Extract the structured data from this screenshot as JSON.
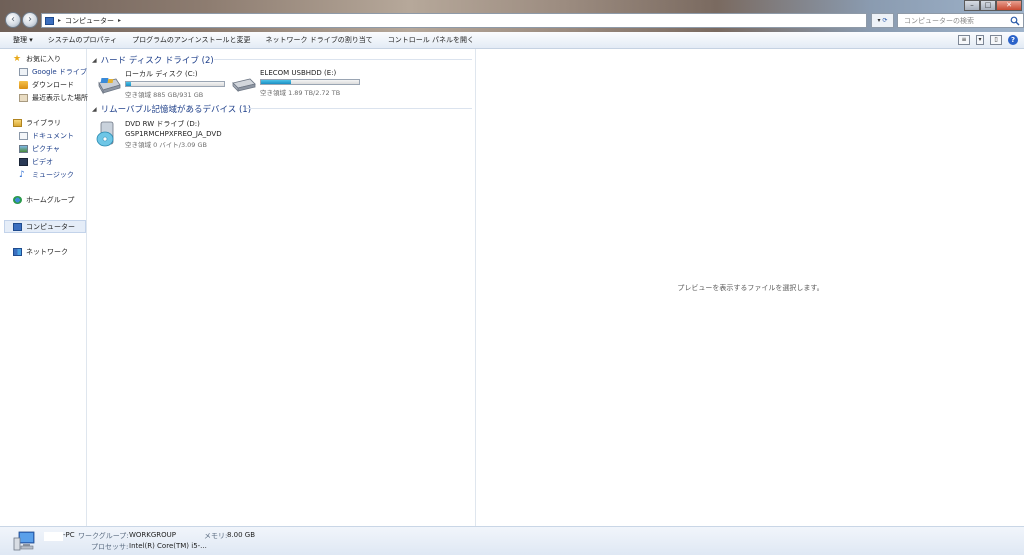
{
  "address": {
    "breadcrumb": "コンピューター"
  },
  "search": {
    "placeholder": "コンピューターの検索"
  },
  "toolbar": {
    "organize": "整理 ▾",
    "system_properties": "システムのプロパティ",
    "uninstall": "プログラムのアンインストールと変更",
    "map_drive": "ネットワーク ドライブの割り当て",
    "control_panel": "コントロール パネルを開く"
  },
  "nav": {
    "favorites": "お気に入り",
    "google_drive": "Google ドライブ",
    "downloads": "ダウンロード",
    "recent": "最近表示した場所",
    "libraries": "ライブラリ",
    "documents": "ドキュメント",
    "pictures": "ピクチャ",
    "videos": "ビデオ",
    "music": "ミュージック",
    "homegroup": "ホームグループ",
    "computer": "コンピューター",
    "network": "ネットワーク"
  },
  "groups": {
    "hdd": "ハード ディスク ドライブ (2)",
    "removable": "リムーバブル記憶域があるデバイス (1)"
  },
  "drives": {
    "c": {
      "name": "ローカル ディスク (C:)",
      "free": "空き領域 885 GB/931 GB",
      "used_fraction": 0.05
    },
    "e": {
      "name": "ELECOM USBHDD (E:)",
      "free": "空き領域 1.89 TB/2.72 TB",
      "used_fraction": 0.31
    },
    "d": {
      "name": "DVD RW ドライブ (D:)",
      "label": "GSP1RMCHPXFREO_JA_DVD",
      "free": "空き領域 0 バイト/3.09 GB"
    }
  },
  "preview": {
    "message": "プレビューを表示するファイルを選択します。"
  },
  "details": {
    "pc_name": "-PC",
    "workgroup_label": "ワークグループ:",
    "workgroup_value": "WORKGROUP",
    "memory_label": "メモリ:",
    "memory_value": "8.00 GB",
    "processor_label": "プロセッサ:",
    "processor_value": "Intel(R) Core(TM) i5-..."
  },
  "colors": {
    "accent": "#1e3f8a",
    "bar_fill": "#1a8fc4"
  }
}
